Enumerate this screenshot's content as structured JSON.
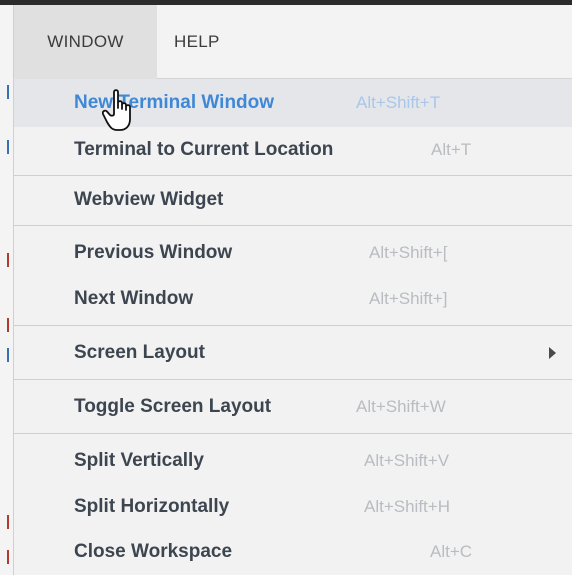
{
  "menubar": {
    "items": [
      {
        "label": "WINDOW",
        "active": true
      },
      {
        "label": "HELP",
        "active": false
      }
    ]
  },
  "menu": {
    "items": [
      {
        "label": "New Terminal Window",
        "shortcut": "Alt+Shift+T",
        "highlighted": true
      },
      {
        "label": "Terminal to Current Location",
        "shortcut": "Alt+T"
      },
      {
        "label": "Webview Widget",
        "shortcut": ""
      },
      {
        "label": "Previous Window",
        "shortcut": "Alt+Shift+["
      },
      {
        "label": "Next Window",
        "shortcut": "Alt+Shift+]"
      },
      {
        "label": "Screen Layout",
        "shortcut": "",
        "has_submenu": true
      },
      {
        "label": "Toggle Screen Layout",
        "shortcut": "Alt+Shift+W"
      },
      {
        "label": "Split Vertically",
        "shortcut": "Alt+Shift+V"
      },
      {
        "label": "Split Horizontally",
        "shortcut": "Alt+Shift+H"
      },
      {
        "label": "Close Workspace",
        "shortcut": "Alt+C"
      }
    ]
  },
  "colors": {
    "highlight_text": "#3f88d6",
    "menu_background": "#f2f2f2",
    "menubar_background": "#f3f3f3"
  },
  "cursor": {
    "icon": "hand-pointer-icon"
  }
}
